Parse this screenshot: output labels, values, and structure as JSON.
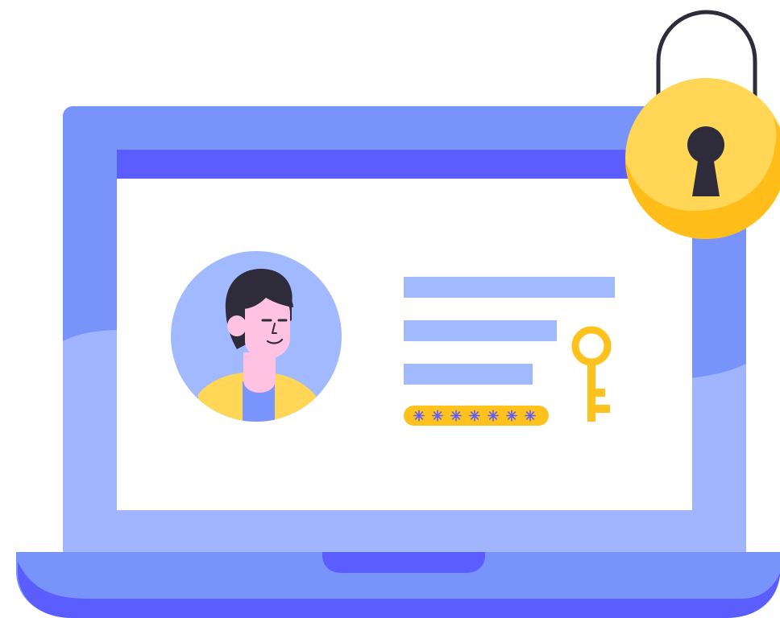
{
  "illustration": {
    "subject": "laptop-login-security",
    "icons": [
      "laptop-icon",
      "user-avatar-icon",
      "padlock-icon",
      "key-icon",
      "password-field-icon"
    ]
  },
  "colors": {
    "laptop_frame": "#7894FB",
    "laptop_frame_light": "#A0B5FD",
    "screen_header": "#5B5DFF",
    "screen_background": "#FFFFFF",
    "form_bar": "#A0B9FF",
    "password_field": "#FFC21C",
    "password_star": "#5B5DFF",
    "key": "#FFC21C",
    "lock_body": "#FFD655",
    "lock_shadow": "#FFBD19",
    "lock_shackle": "#2E2C3A",
    "keyhole": "#2E2C3A",
    "avatar_circle": "#A0B9FF",
    "skin": "#FFC2E2",
    "hair": "#2E2C3A",
    "jacket": "#FFD655",
    "shirt": "#7B95FF",
    "laptop_notch": "#5B5DFF",
    "laptop_base_shadow": "#5B5DFF"
  },
  "login_form": {
    "text_lines": 3,
    "password_masked_glyphs": 7
  }
}
